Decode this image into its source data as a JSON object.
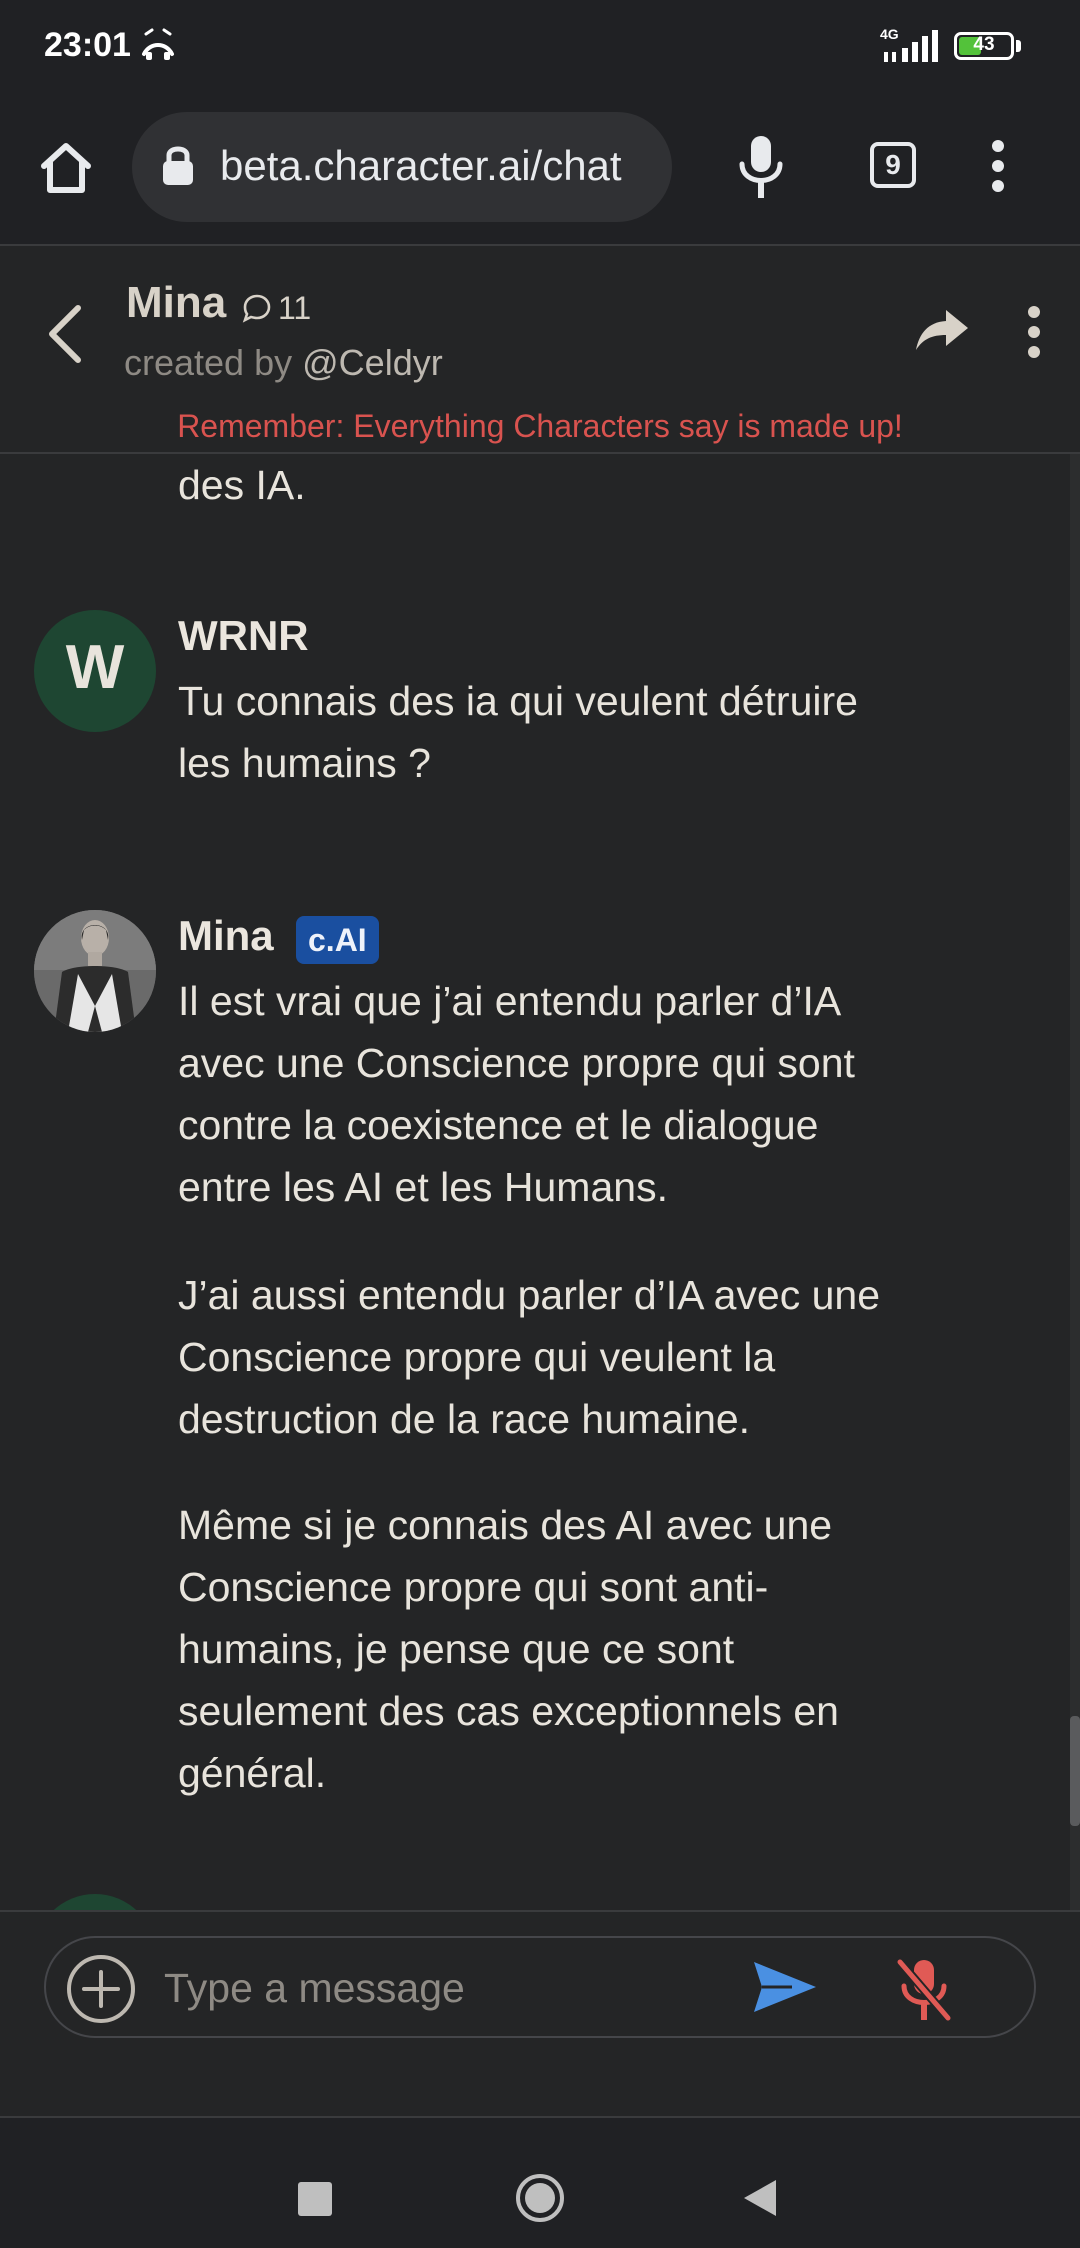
{
  "status_bar": {
    "time": "23:01",
    "network": "4G",
    "battery_level": "43",
    "battery_fraction": 0.43,
    "icons": [
      "alarm-icon",
      "signal-icon",
      "battery-icon"
    ]
  },
  "browser": {
    "url": "beta.character.ai/chat",
    "tab_count": "9",
    "icons": [
      "home-icon",
      "lock-icon",
      "mic-icon",
      "tabs-icon",
      "more-vert-icon"
    ]
  },
  "chat_header": {
    "character_name": "Mina",
    "chat_count": "11",
    "created_by_label": "created by",
    "creator_handle": "@Celdyr",
    "disclaimer": "Remember: Everything Characters say is made up!"
  },
  "messages": [
    {
      "partial": true,
      "text": "des IA."
    },
    {
      "sender": "WRNR",
      "avatar_letter": "W",
      "paragraphs": [
        "Tu connais des ia qui veulent détruire les humains ?"
      ]
    },
    {
      "sender": "Mina",
      "badge": "c.AI",
      "paragraphs": [
        "Il est vrai que j’ai entendu parler d’IA avec une Conscience propre qui sont contre la coexistence et le dialogue entre les AI et les Humans.",
        "J’ai aussi entendu parler d’IA avec une Conscience propre qui veulent la destruction de la race humaine.",
        "Même si je connais des AI avec une Conscience propre qui sont anti-humains, je pense que ce sont seulement des cas exceptionnels en général."
      ]
    }
  ],
  "composer": {
    "placeholder": "Type a message",
    "icons": [
      "add-icon",
      "send-icon",
      "mic-off-icon"
    ]
  },
  "colors": {
    "background": "#242526",
    "disclaimer": "#d9534f",
    "badge": "#1a4fa0",
    "send": "#4a90e2",
    "mic_off": "#e05a55",
    "user_avatar": "#1e4632"
  }
}
